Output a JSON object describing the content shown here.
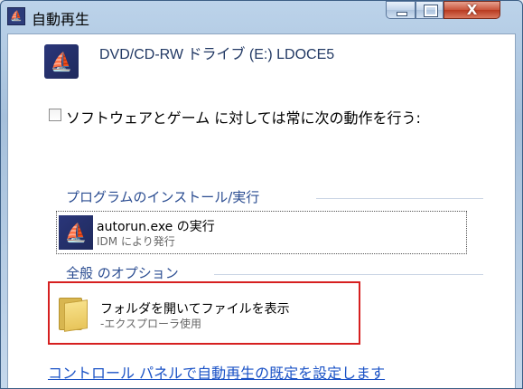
{
  "window": {
    "title": "自動再生",
    "close_label": "X"
  },
  "drive": {
    "title": "DVD/CD-RW ドライブ (E:) LDOCE5"
  },
  "option": {
    "always_label": "ソフトウェアとゲーム に対しては常に次の動作を行う:",
    "checked": false
  },
  "groups": [
    {
      "header": "プログラムのインストール/実行"
    },
    {
      "header": "全般 のオプション"
    }
  ],
  "items": {
    "autorun": {
      "title": "autorun.exe の実行",
      "subtitle": "IDM により発行"
    },
    "folder": {
      "title": "フォルダを開いてファイルを表示",
      "subtitle": "-エクスプローラ使用"
    }
  },
  "footer": {
    "link": "コントロール パネルで自動再生の既定を設定します"
  },
  "colors": {
    "accent": "#2a4c91",
    "link": "#1a52c6",
    "highlight_border": "#d62020",
    "icon_bg": "#2a367a"
  }
}
